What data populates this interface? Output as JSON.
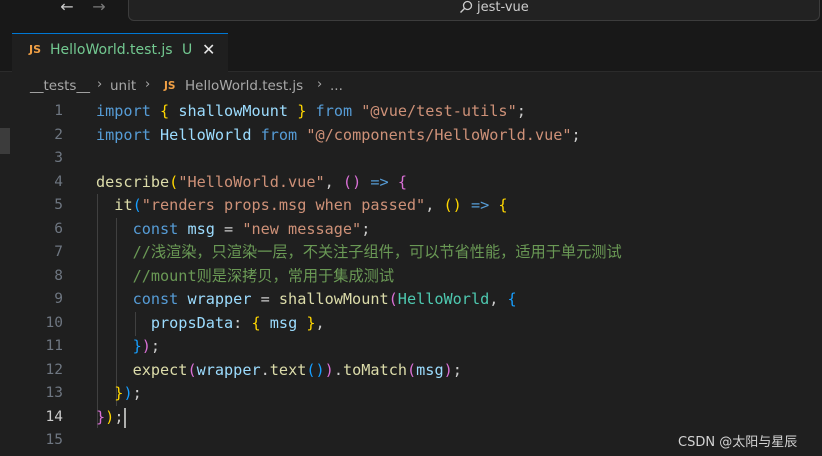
{
  "titlebar": {
    "back_icon": "←",
    "forward_icon": "→",
    "search_text": "jest-vue"
  },
  "tab": {
    "badge": "JS",
    "name": "HelloWorld.test.js",
    "status": "U",
    "close_icon": "✕"
  },
  "breadcrumbs": {
    "items": [
      "__tests__",
      "unit",
      "HelloWorld.test.js",
      "..."
    ],
    "file_badge": "JS",
    "separator": "›"
  },
  "editor": {
    "active_line": 14,
    "line_numbers": [
      "1",
      "2",
      "3",
      "4",
      "5",
      "6",
      "7",
      "8",
      "9",
      "10",
      "11",
      "12",
      "13",
      "14",
      "15"
    ],
    "lines": [
      [
        [
          "kw",
          "import"
        ],
        [
          "pl",
          " "
        ],
        [
          "b1",
          "{"
        ],
        [
          "pl",
          " "
        ],
        [
          "var",
          "shallowMount"
        ],
        [
          "pl",
          " "
        ],
        [
          "b1",
          "}"
        ],
        [
          "pl",
          " "
        ],
        [
          "kw",
          "from"
        ],
        [
          "pl",
          " "
        ],
        [
          "str",
          "\"@vue/test-utils\""
        ],
        [
          "pl",
          ";"
        ]
      ],
      [
        [
          "kw",
          "import"
        ],
        [
          "pl",
          " "
        ],
        [
          "var",
          "HelloWorld"
        ],
        [
          "pl",
          " "
        ],
        [
          "kw",
          "from"
        ],
        [
          "pl",
          " "
        ],
        [
          "str",
          "\"@/components/HelloWorld.vue\""
        ],
        [
          "pl",
          ";"
        ]
      ],
      [],
      [
        [
          "fn",
          "describe"
        ],
        [
          "b1",
          "("
        ],
        [
          "str",
          "\"HelloWorld.vue\""
        ],
        [
          "pl",
          ", "
        ],
        [
          "b2",
          "("
        ],
        [
          "b2",
          ")"
        ],
        [
          "pl",
          " "
        ],
        [
          "kw",
          "=>"
        ],
        [
          "pl",
          " "
        ],
        [
          "b2",
          "{"
        ]
      ],
      [
        [
          "pl",
          "  "
        ],
        [
          "fn",
          "it"
        ],
        [
          "b3",
          "("
        ],
        [
          "str",
          "\"renders props.msg when passed\""
        ],
        [
          "pl",
          ", "
        ],
        [
          "b1",
          "("
        ],
        [
          "b1",
          ")"
        ],
        [
          "pl",
          " "
        ],
        [
          "kw",
          "=>"
        ],
        [
          "pl",
          " "
        ],
        [
          "b1",
          "{"
        ]
      ],
      [
        [
          "pl",
          "    "
        ],
        [
          "kw",
          "const"
        ],
        [
          "pl",
          " "
        ],
        [
          "var",
          "msg"
        ],
        [
          "pl",
          " = "
        ],
        [
          "str",
          "\"new message\""
        ],
        [
          "pl",
          ";"
        ]
      ],
      [
        [
          "pl",
          "    "
        ],
        [
          "cm",
          "//浅渲染，只渲染一层，不关注子组件，可以节省性能，适用于单元测试"
        ]
      ],
      [
        [
          "pl",
          "    "
        ],
        [
          "cm",
          "//mount则是深拷贝，常用于集成测试"
        ]
      ],
      [
        [
          "pl",
          "    "
        ],
        [
          "kw",
          "const"
        ],
        [
          "pl",
          " "
        ],
        [
          "var",
          "wrapper"
        ],
        [
          "pl",
          " = "
        ],
        [
          "fn",
          "shallowMount"
        ],
        [
          "b2",
          "("
        ],
        [
          "cls",
          "HelloWorld"
        ],
        [
          "pl",
          ", "
        ],
        [
          "b3",
          "{"
        ]
      ],
      [
        [
          "pl",
          "      "
        ],
        [
          "var",
          "propsData"
        ],
        [
          "pl",
          ": "
        ],
        [
          "b1",
          "{"
        ],
        [
          "pl",
          " "
        ],
        [
          "var",
          "msg"
        ],
        [
          "pl",
          " "
        ],
        [
          "b1",
          "}"
        ],
        [
          "pl",
          ","
        ]
      ],
      [
        [
          "pl",
          "    "
        ],
        [
          "b3",
          "}"
        ],
        [
          "b2",
          ")"
        ],
        [
          "pl",
          ";"
        ]
      ],
      [
        [
          "pl",
          "    "
        ],
        [
          "fn",
          "expect"
        ],
        [
          "b2",
          "("
        ],
        [
          "var",
          "wrapper"
        ],
        [
          "pl",
          "."
        ],
        [
          "fn",
          "text"
        ],
        [
          "b3",
          "("
        ],
        [
          "b3",
          ")"
        ],
        [
          "b2",
          ")"
        ],
        [
          "pl",
          "."
        ],
        [
          "fn",
          "toMatch"
        ],
        [
          "b2",
          "("
        ],
        [
          "var",
          "msg"
        ],
        [
          "b2",
          ")"
        ],
        [
          "pl",
          ";"
        ]
      ],
      [
        [
          "pl",
          "  "
        ],
        [
          "b1",
          "}"
        ],
        [
          "b3",
          ")"
        ],
        [
          "pl",
          ";"
        ]
      ],
      [
        [
          "b2",
          "}"
        ],
        [
          "b1",
          ")"
        ],
        [
          "pl",
          ";"
        ]
      ],
      []
    ]
  },
  "watermark": "CSDN @太阳与星辰",
  "colors": {
    "background": "#1f1f1f",
    "accent": "#0078d4",
    "untracked": "#73c991"
  }
}
